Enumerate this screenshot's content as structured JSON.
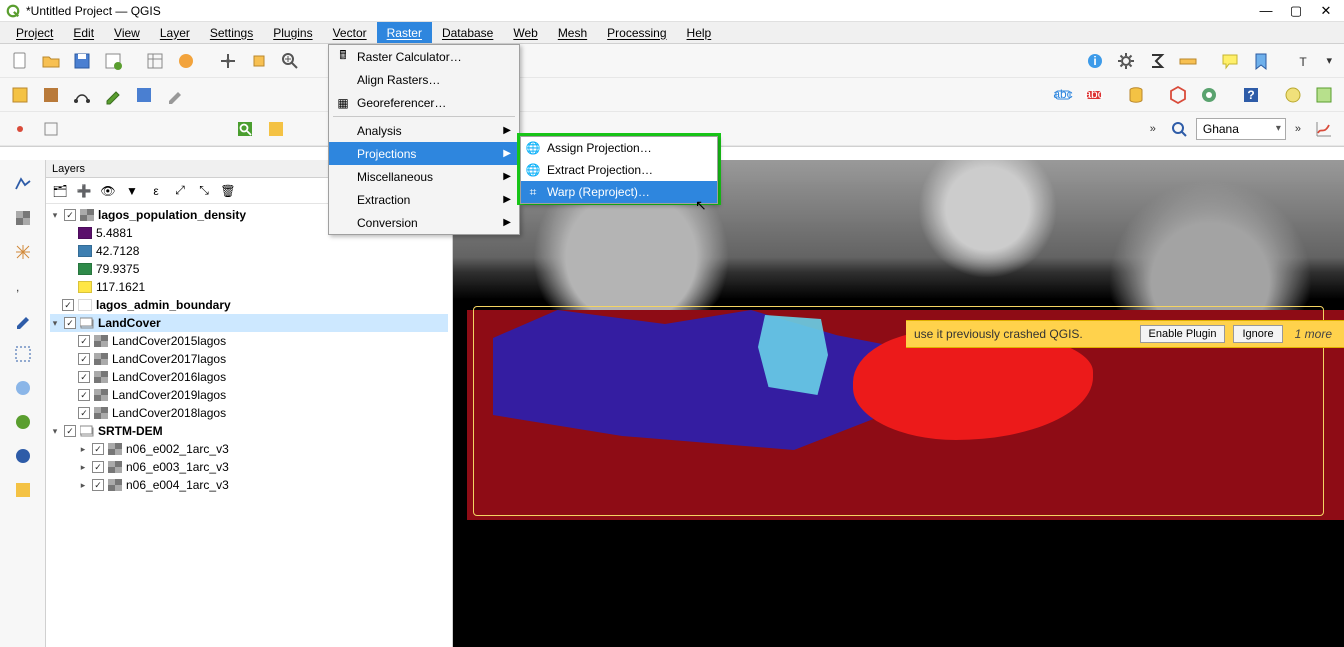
{
  "window": {
    "title": "*Untitled Project — QGIS"
  },
  "menus": {
    "project": "Project",
    "edit": "Edit",
    "view": "View",
    "layer": "Layer",
    "settings": "Settings",
    "plugins": "Plugins",
    "vector": "Vector",
    "raster": "Raster",
    "database": "Database",
    "web": "Web",
    "mesh": "Mesh",
    "processing": "Processing",
    "help": "Help"
  },
  "raster_menu": {
    "calc": "Raster Calculator…",
    "align": "Align Rasters…",
    "georef": "Georeferencer…",
    "analysis": "Analysis",
    "projections": "Projections",
    "misc": "Miscellaneous",
    "extraction": "Extraction",
    "conversion": "Conversion"
  },
  "projections_submenu": {
    "assign": "Assign Projection…",
    "extract": "Extract Projection…",
    "warp": "Warp (Reproject)…"
  },
  "toolbar3": {
    "search_value": "Ghana"
  },
  "notification": {
    "message_tail": "use it previously crashed QGIS.",
    "enable": "Enable Plugin",
    "ignore": "Ignore",
    "more": "1 more"
  },
  "layers_panel": {
    "title": "Layers"
  },
  "tree": {
    "g_pop": "lagos_population_density",
    "pop_syms": [
      {
        "color": "#5a0f6b",
        "label": "5.4881"
      },
      {
        "color": "#3e7fb1",
        "label": "42.7128"
      },
      {
        "color": "#2e8a49",
        "label": "79.9375"
      },
      {
        "color": "#ffe646",
        "label": "117.1621"
      }
    ],
    "admin": "lagos_admin_boundary",
    "landcover_group": "LandCover",
    "landcover": [
      "LandCover2015lagos",
      "LandCover2017lagos",
      "LandCover2016lagos",
      "LandCover2019lagos",
      "LandCover2018lagos"
    ],
    "srtm_group": "SRTM-DEM",
    "srtm": [
      "n06_e002_1arc_v3",
      "n06_e003_1arc_v3",
      "n06_e004_1arc_v3"
    ]
  }
}
